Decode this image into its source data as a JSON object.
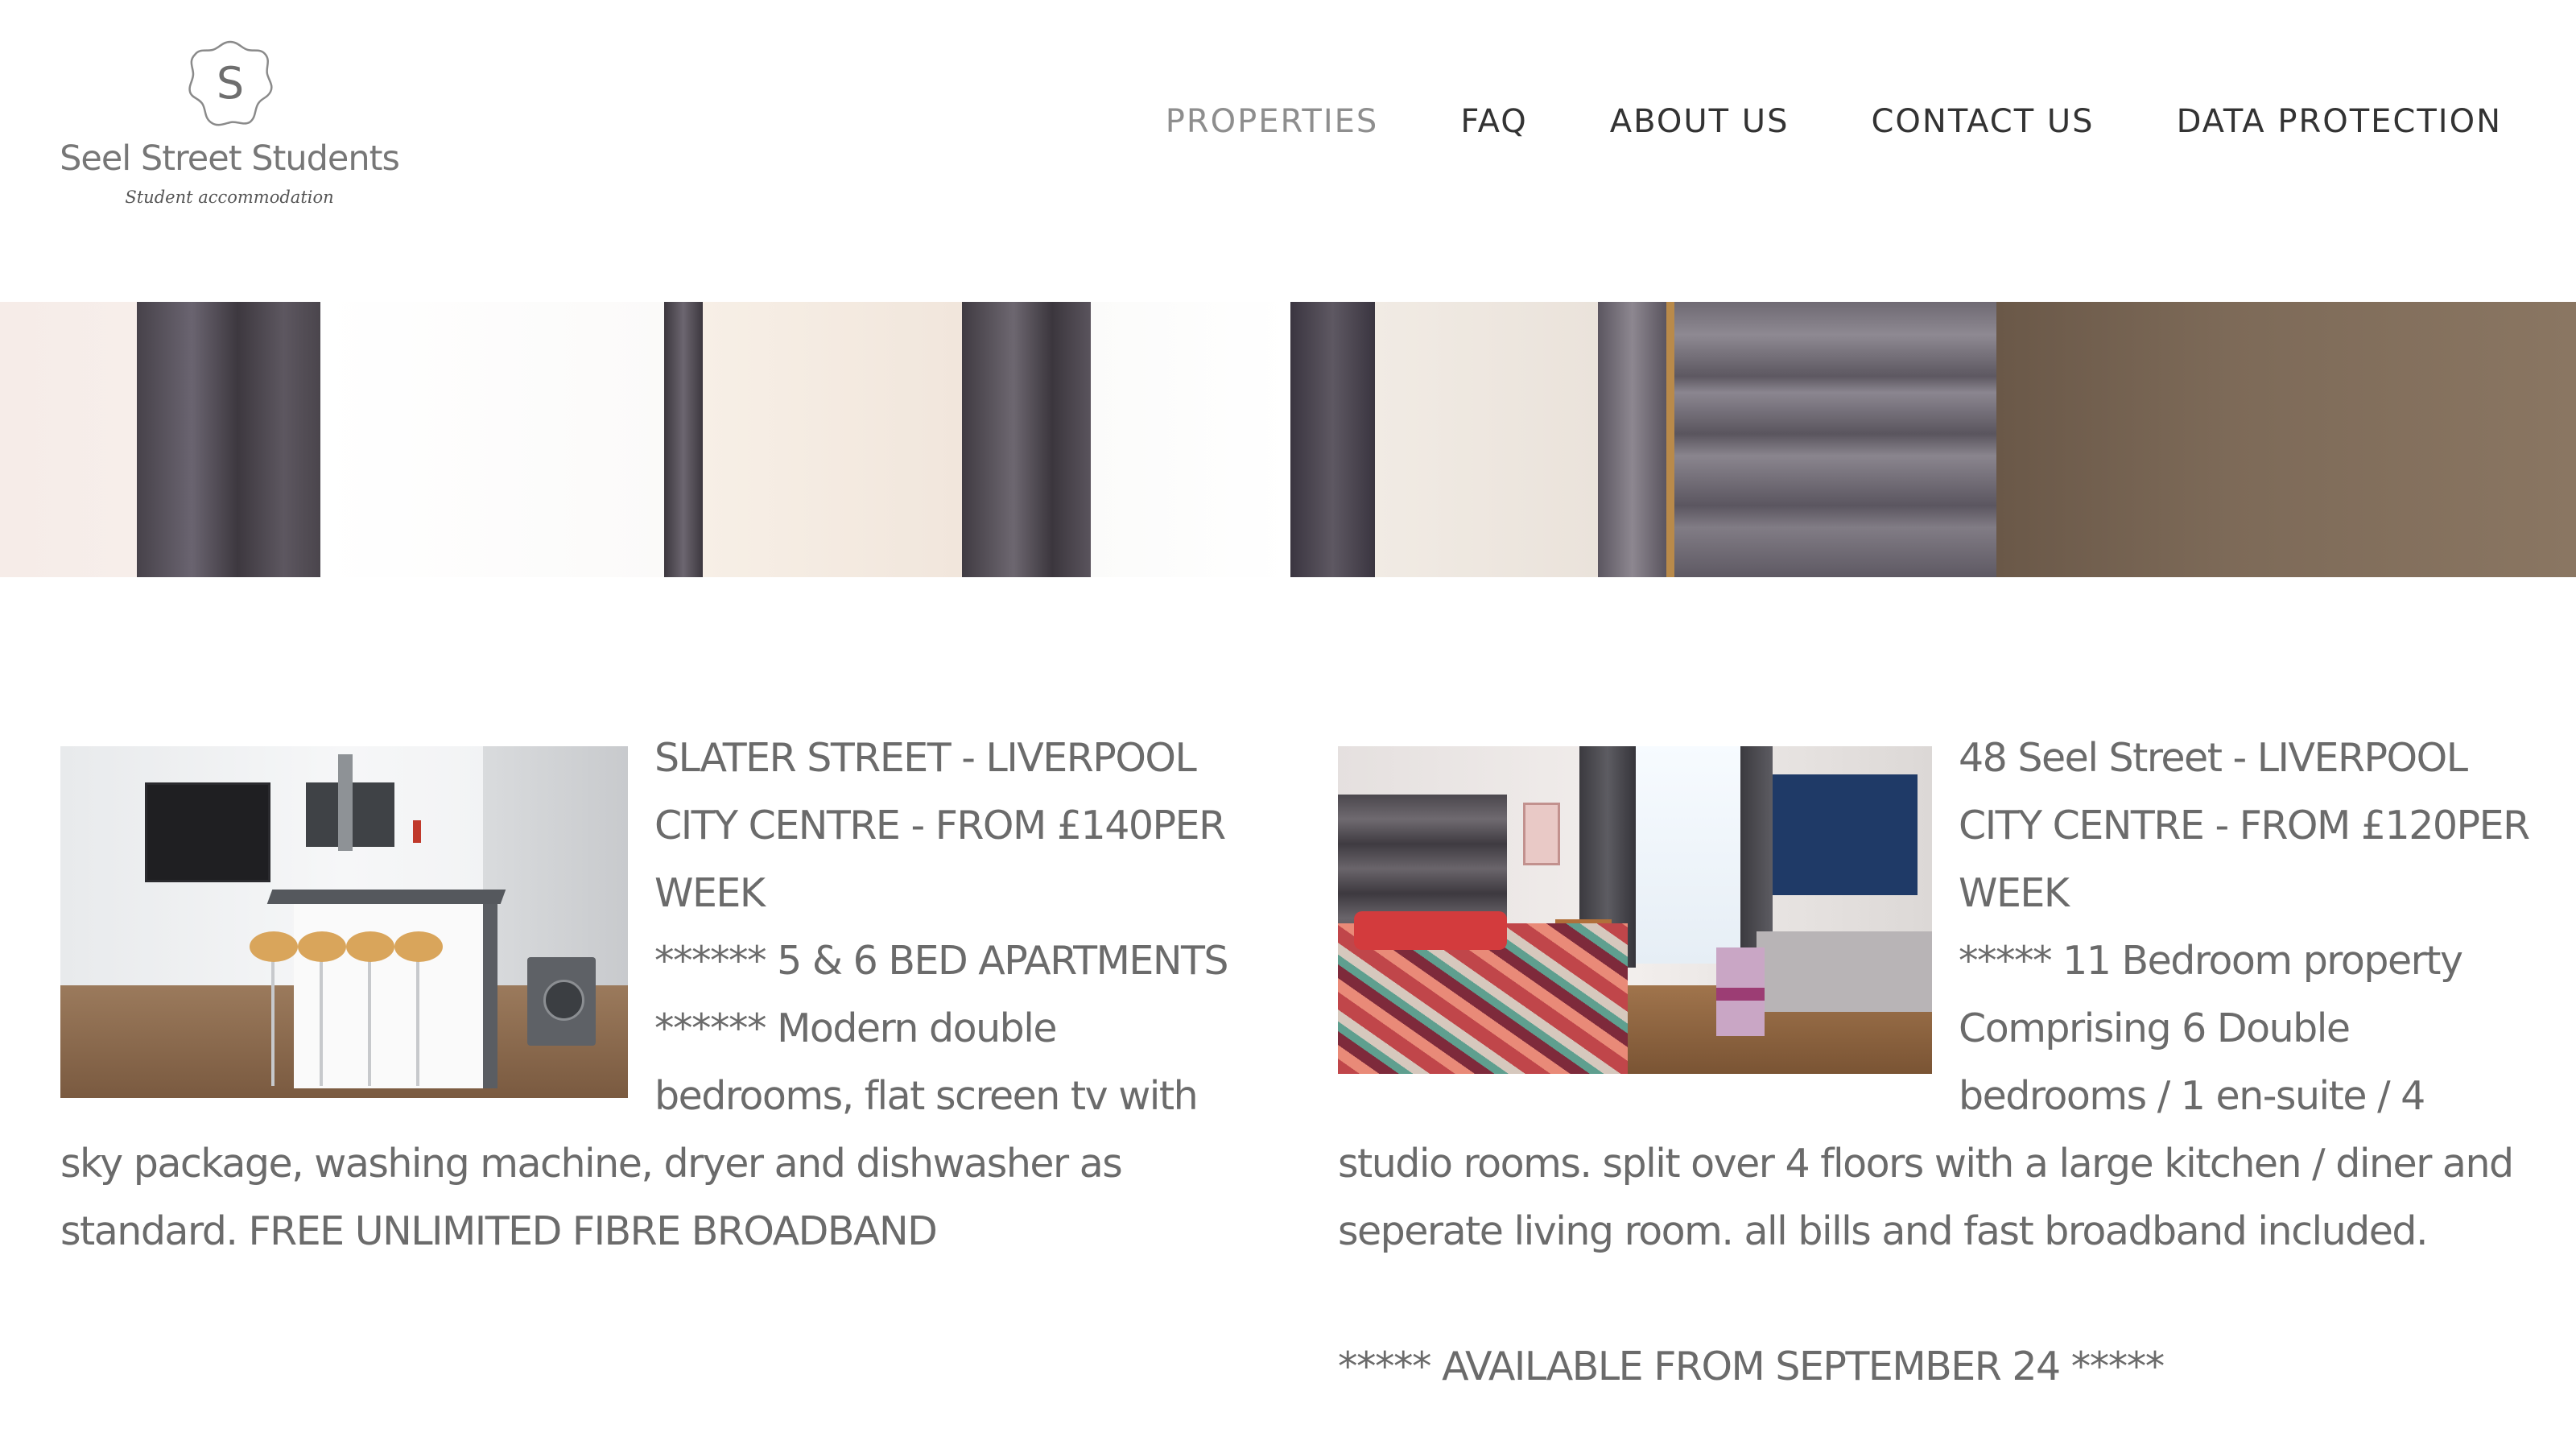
{
  "header": {
    "logo": {
      "monogram": "S",
      "name": "Seel Street Students",
      "tagline": "Student accommodation"
    },
    "nav": [
      {
        "label": "PROPERTIES",
        "active": true
      },
      {
        "label": "FAQ",
        "active": false
      },
      {
        "label": "ABOUT US",
        "active": false
      },
      {
        "label": "CONTACT US",
        "active": false
      },
      {
        "label": "DATA PROTECTION",
        "active": false
      }
    ]
  },
  "listings": [
    {
      "title": "SLATER STREET - LIVERPOOL CITY CENTRE - FROM £140PER WEEK",
      "description": "****** 5 & 6 BED APARTMENTS ****** Modern double bedrooms, flat screen tv with sky package, washing machine, dryer and dishwasher as standard. FREE UNLIMITED FIBRE BROADBAND",
      "availability": ""
    },
    {
      "title": "48 Seel Street - LIVERPOOL CITY CENTRE - FROM £120PER WEEK",
      "description": "***** 11 Bedroom property Comprising 6 Double bedrooms / 1 en-suite / 4 studio rooms. split over 4 floors with a large kitchen / diner and seperate living room. all bills and fast broadband included.",
      "availability": "***** AVAILABLE FROM SEPTEMBER 24 *****"
    }
  ],
  "colors": {
    "text": "#6b6b6b",
    "nav_text": "#333333",
    "nav_active": "#8e8e8e",
    "background": "#ffffff"
  }
}
